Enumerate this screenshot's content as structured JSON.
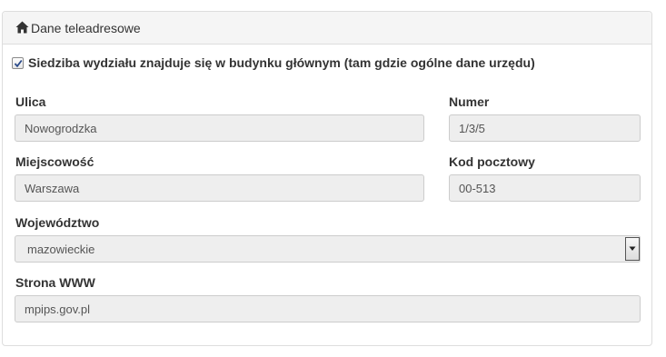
{
  "panel": {
    "title": "Dane teleadresowe",
    "title_icon": "home-icon"
  },
  "checkbox": {
    "checked": true,
    "label": "Siedziba wydziału znajduje się w budynku głównym (tam gdzie ogólne dane urzędu)"
  },
  "fields": {
    "street": {
      "label": "Ulica",
      "value": "Nowogrodzka"
    },
    "number": {
      "label": "Numer",
      "value": "1/3/5"
    },
    "city": {
      "label": "Miejscowość",
      "value": "Warszawa"
    },
    "postal_code": {
      "label": "Kod pocztowy",
      "value": "00-513"
    },
    "voivodeship": {
      "label": "Województwo",
      "value": "mazowieckie"
    },
    "website": {
      "label": "Strona WWW",
      "value": "mpips.gov.pl"
    }
  }
}
